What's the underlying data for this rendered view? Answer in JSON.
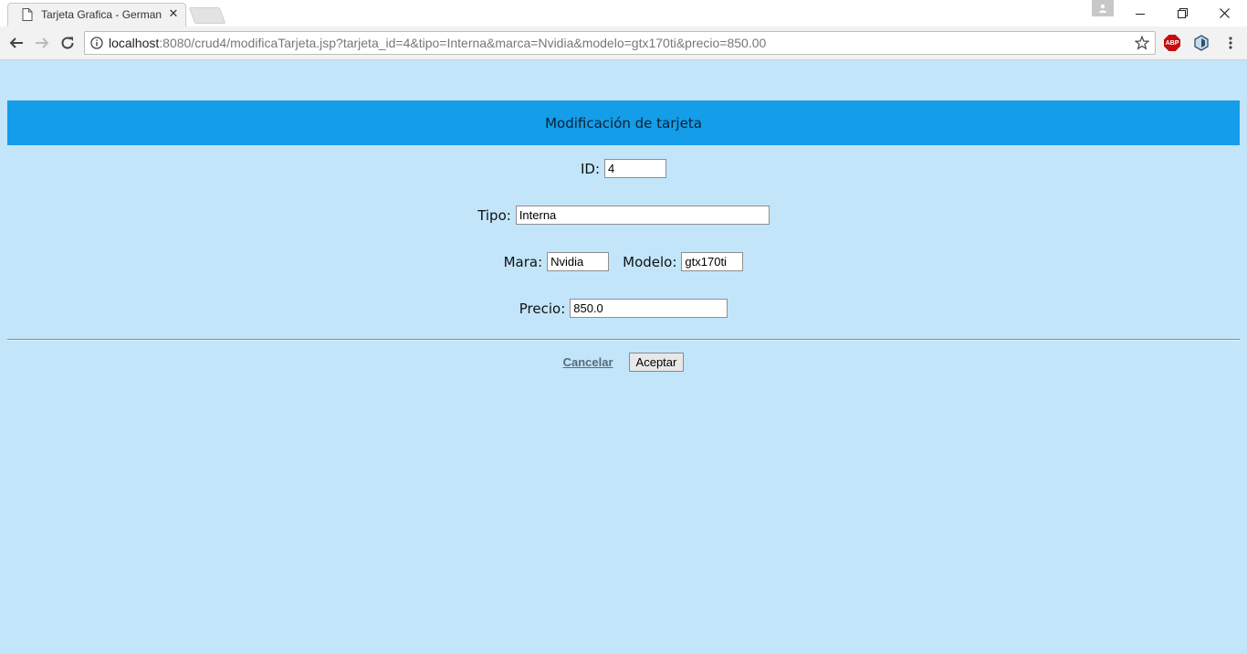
{
  "browser": {
    "tab_title": "Tarjeta Grafica - German",
    "url_host": "localhost",
    "url_rest": ":8080/crud4/modificaTarjeta.jsp?tarjeta_id=4&tipo=Interna&marca=Nvidia&modelo=gtx170ti&precio=850.00",
    "extensions": [
      "adblock-plus-icon",
      "shield-extension-icon"
    ],
    "abp_text": "ABP"
  },
  "page": {
    "title": "Modificación de tarjeta",
    "fields": {
      "id": {
        "label": "ID:",
        "value": "4"
      },
      "tipo": {
        "label": "Tipo:",
        "value": "Interna"
      },
      "marca": {
        "label": "Mara:",
        "value": "Nvidia"
      },
      "modelo": {
        "label": "Modelo:",
        "value": "gtx170ti"
      },
      "precio": {
        "label": "Precio:",
        "value": "850.0"
      }
    },
    "actions": {
      "cancel": "Cancelar",
      "accept": "Aceptar"
    }
  },
  "colors": {
    "page_background": "#c2e5fa",
    "header_background": "#149de9"
  }
}
